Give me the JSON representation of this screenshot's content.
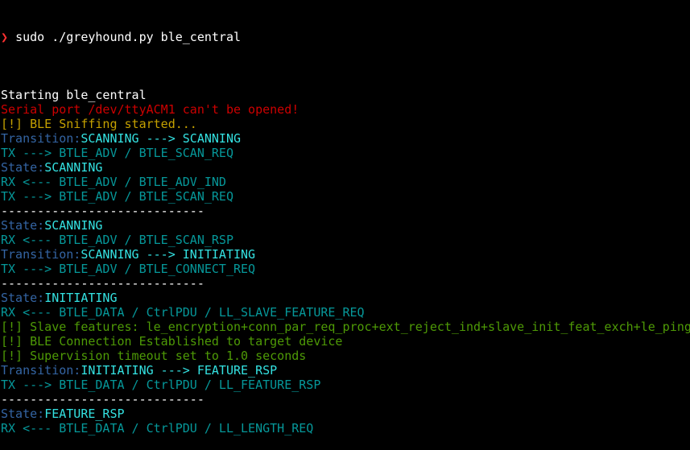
{
  "terminal": {
    "prompt_symbol": "❯",
    "command": "sudo ./greyhound.py ble_central",
    "colors": {
      "w": "#ffffff",
      "r": "#cc0000",
      "y": "#c4a000",
      "b": "#3465a4",
      "bc": "#34e2e2",
      "c": "#06989a",
      "g": "#4e9a06",
      "p": "#ff3030"
    },
    "lines": [
      [],
      [
        [
          "w",
          "Starting ble_central"
        ]
      ],
      [
        [
          "r",
          "Serial port /dev/ttyACM1 can't be opened!"
        ]
      ],
      [
        [
          "y",
          "[!] BLE Sniffing started..."
        ]
      ],
      [
        [
          "b",
          "Transition:"
        ],
        [
          "bc",
          "SCANNING ---> SCANNING"
        ]
      ],
      [
        [
          "c",
          "TX ---> BTLE_ADV / BTLE_SCAN_REQ"
        ]
      ],
      [
        [
          "b",
          "State:"
        ],
        [
          "bc",
          "SCANNING"
        ]
      ],
      [
        [
          "c",
          "RX <--- BTLE_ADV / BTLE_ADV_IND"
        ]
      ],
      [
        [
          "c",
          "TX ---> BTLE_ADV / BTLE_SCAN_REQ"
        ]
      ],
      [
        [
          "w",
          "----------------------------"
        ]
      ],
      [
        [
          "b",
          "State:"
        ],
        [
          "bc",
          "SCANNING"
        ]
      ],
      [
        [
          "c",
          "RX <--- BTLE_ADV / BTLE_SCAN_RSP"
        ]
      ],
      [
        [
          "b",
          "Transition:"
        ],
        [
          "bc",
          "SCANNING ---> INITIATING"
        ]
      ],
      [
        [
          "c",
          "TX ---> BTLE_ADV / BTLE_CONNECT_REQ"
        ]
      ],
      [
        [
          "w",
          "----------------------------"
        ]
      ],
      [
        [
          "b",
          "State:"
        ],
        [
          "bc",
          "INITIATING"
        ]
      ],
      [
        [
          "c",
          "RX <--- BTLE_DATA / CtrlPDU / LL_SLAVE_FEATURE_REQ"
        ]
      ],
      [
        [
          "g",
          "[!] Slave features: le_encryption+conn_par_req_proc+ext_reject_ind+slave_init_feat_exch+le_ping"
        ]
      ],
      [
        [
          "g",
          "[!] BLE Connection Established to target device"
        ]
      ],
      [
        [
          "g",
          "[!] Supervision timeout set to 1.0 seconds"
        ]
      ],
      [
        [
          "b",
          "Transition:"
        ],
        [
          "bc",
          "INITIATING ---> FEATURE_RSP"
        ]
      ],
      [
        [
          "c",
          "TX ---> BTLE_DATA / CtrlPDU / LL_FEATURE_RSP"
        ]
      ],
      [
        [
          "w",
          "----------------------------"
        ]
      ],
      [
        [
          "b",
          "State:"
        ],
        [
          "bc",
          "FEATURE_RSP"
        ]
      ],
      [
        [
          "c",
          "RX <--- BTLE_DATA / CtrlPDU / LL_LENGTH_REQ"
        ]
      ]
    ]
  }
}
